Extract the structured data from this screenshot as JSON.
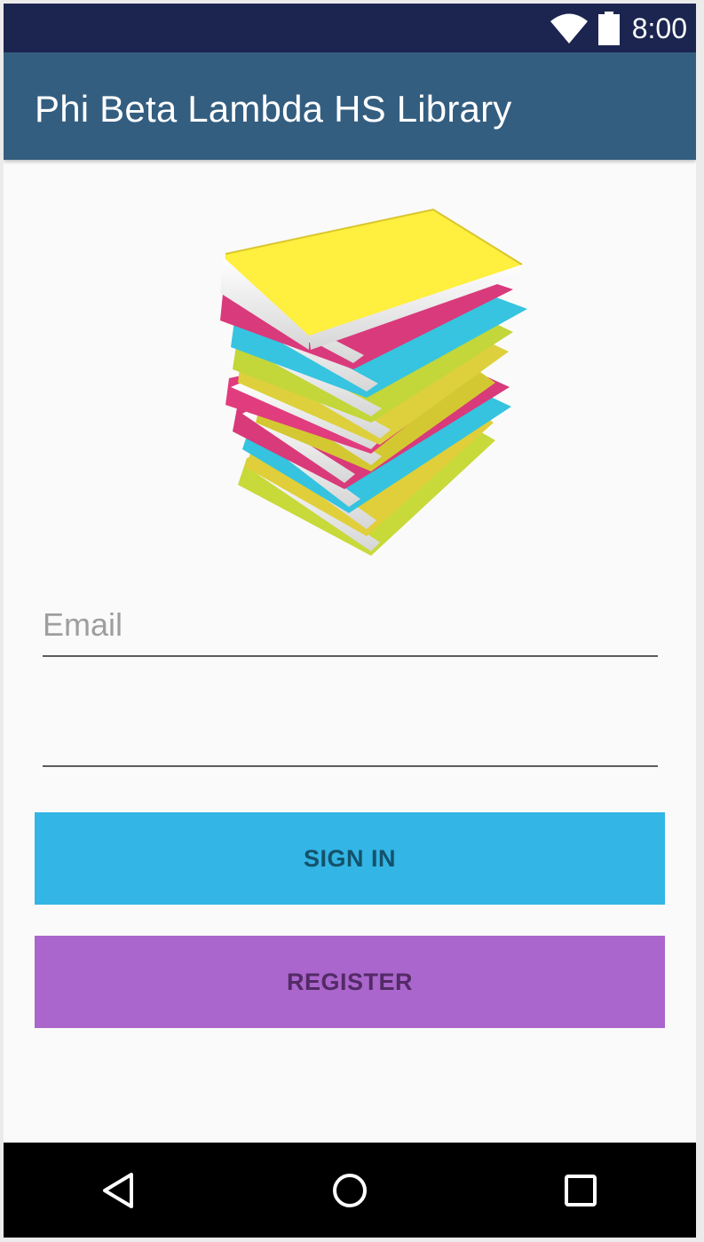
{
  "status_bar": {
    "time": "8:00",
    "icons": [
      "wifi-icon",
      "battery-icon"
    ],
    "background": "#1c2550"
  },
  "app_bar": {
    "title": "Phi Beta Lambda HS Library",
    "background": "#345e80"
  },
  "hero": {
    "image": "book-stack-illustration"
  },
  "form": {
    "email_placeholder": "Email",
    "email_value": "",
    "password_value": ""
  },
  "buttons": {
    "sign_in": {
      "label": "SIGN IN",
      "color": "#33b5e5"
    },
    "register": {
      "label": "REGISTER",
      "color": "#aa66cc"
    }
  },
  "nav_bar": {
    "icons": [
      "back-icon",
      "home-icon",
      "recents-icon"
    ]
  }
}
